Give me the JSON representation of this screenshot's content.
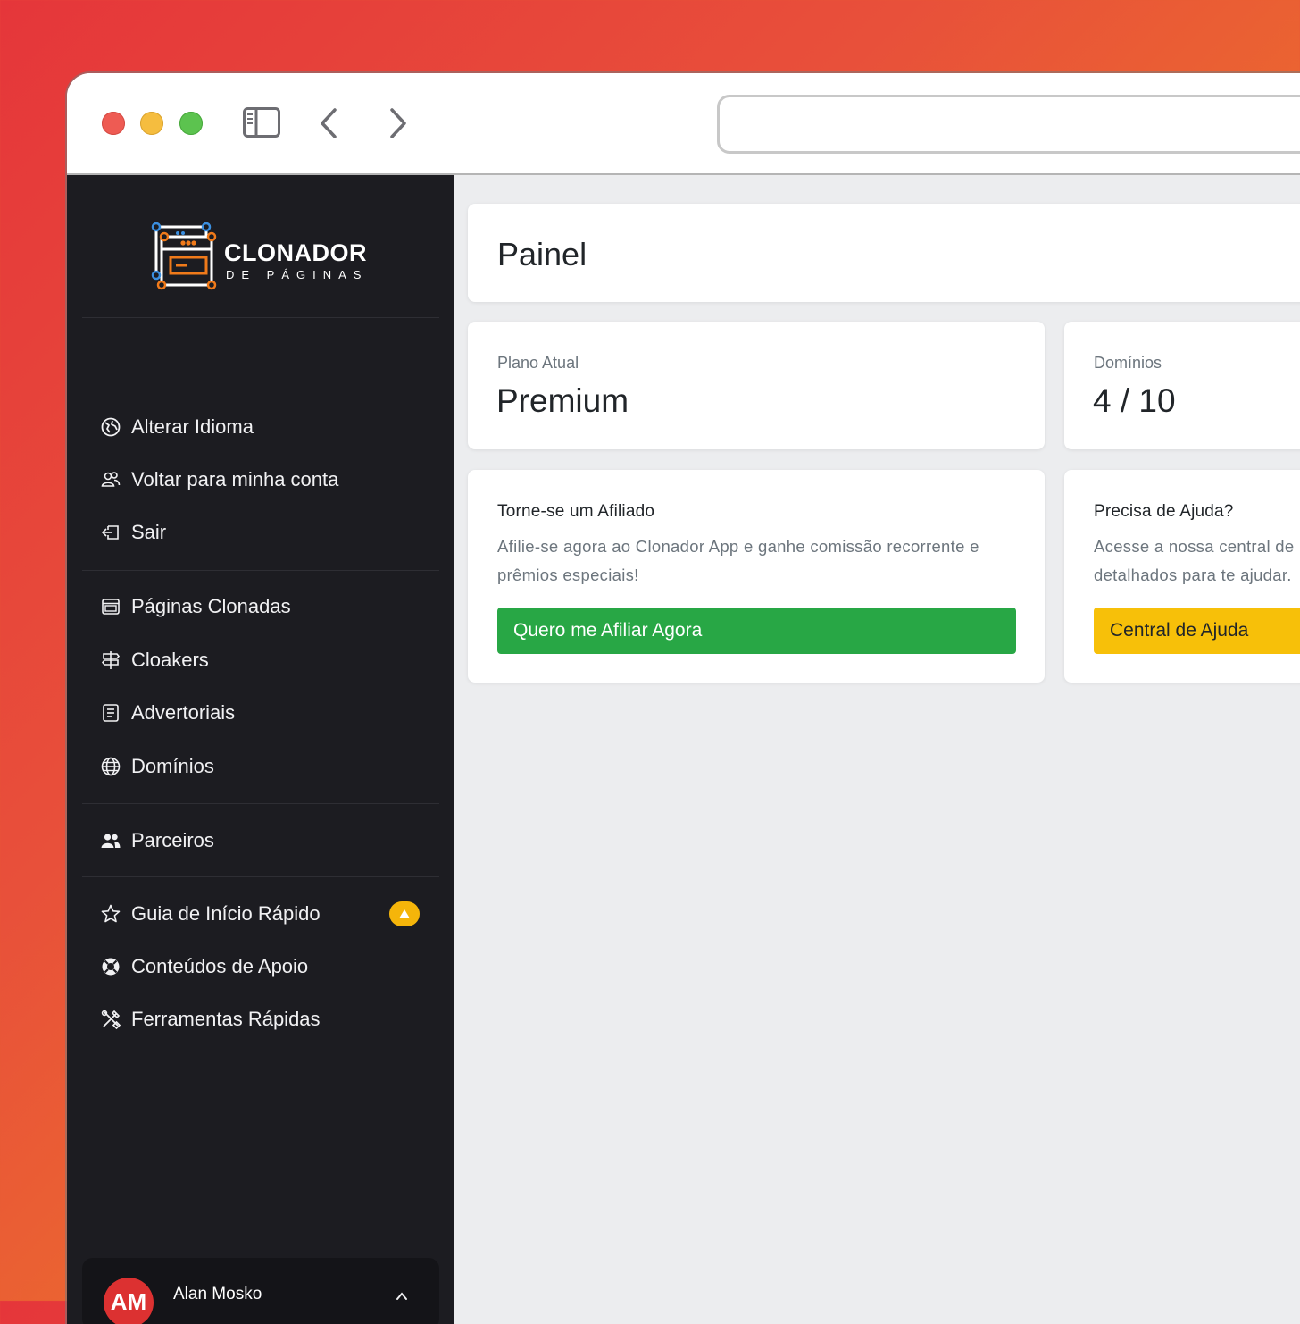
{
  "window": {
    "controls": [
      "close",
      "minimize",
      "zoom"
    ],
    "toolbar_icons": [
      "sidebar-toggle-icon",
      "back-icon",
      "forward-icon"
    ],
    "url": ""
  },
  "brand": {
    "name": "CLONADOR",
    "tagline": "DE PÁGINAS"
  },
  "sidebar": {
    "group1": [
      {
        "label": "Alterar Idioma",
        "icon": "globe-icon"
      },
      {
        "label": "Voltar para minha conta",
        "icon": "users-icon"
      },
      {
        "label": "Sair",
        "icon": "logout-icon"
      }
    ],
    "group2": [
      {
        "label": "Páginas Clonadas",
        "icon": "pages-icon"
      },
      {
        "label": "Cloakers",
        "icon": "signpost-icon"
      },
      {
        "label": "Advertoriais",
        "icon": "document-icon"
      },
      {
        "label": "Domínios",
        "icon": "world-icon"
      }
    ],
    "group3": [
      {
        "label": "Parceiros",
        "icon": "people-icon"
      }
    ],
    "group4": [
      {
        "label": "Guia de Início Rápido",
        "icon": "star-icon",
        "badge": "warning"
      },
      {
        "label": "Conteúdos de Apoio",
        "icon": "lifebuoy-icon"
      },
      {
        "label": "Ferramentas Rápidas",
        "icon": "tools-icon"
      }
    ]
  },
  "user": {
    "initials": "AM",
    "name": "Alan Mosko"
  },
  "main": {
    "title": "Painel",
    "plan": {
      "label": "Plano Atual",
      "value": "Premium"
    },
    "domains": {
      "label": "Domínios",
      "value": "4 / 10"
    },
    "affiliate": {
      "title": "Torne-se um Afiliado",
      "text_line1": "Afilie-se agora ao Clonador App e ganhe comissão recorrente e",
      "text_line2": "prêmios especiais!",
      "button": "Quero me Afiliar Agora"
    },
    "help": {
      "title": "Precisa de Ajuda?",
      "text_line1": "Acesse a nossa central de",
      "text_line2": "detalhados para te ajudar.",
      "button": "Central de Ajuda"
    }
  },
  "colors": {
    "sidebar_bg": "#1c1c21",
    "main_bg": "#ecedef",
    "affiliate_button": "#28a745",
    "help_button": "#f7c009",
    "badge": "#f5b50a",
    "avatar": "#dc3131",
    "logo_orange": "#f07a1a",
    "logo_blue": "#3b8fe0"
  }
}
